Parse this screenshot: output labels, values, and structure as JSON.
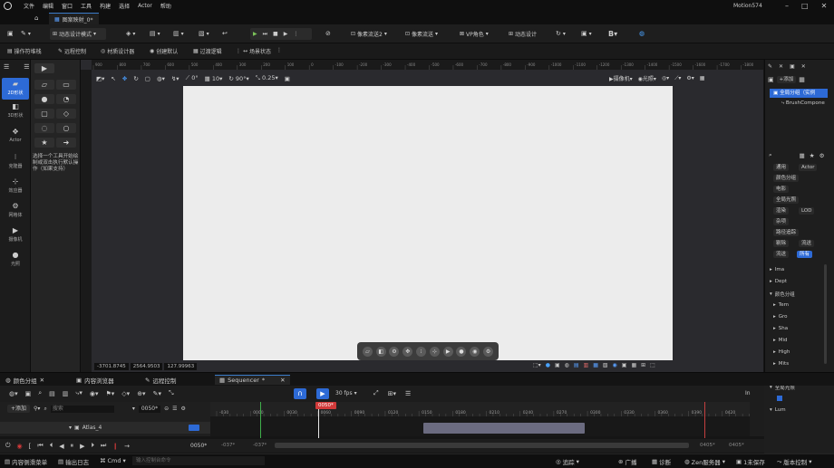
{
  "app": {
    "title": "Motion574",
    "logo": "unreal-engine-logo"
  },
  "menu": [
    "文件",
    "编辑",
    "窗口",
    "工具",
    "构建",
    "选择",
    "Actor",
    "帮助"
  ],
  "window_controls": [
    "minimize",
    "maximize",
    "close"
  ],
  "document_tab": {
    "label": "图案映射_0*"
  },
  "toolbar": {
    "mode_label": "动态设计模式",
    "pixel_stream_1": "像素流送2",
    "pixel_stream_2": "像素流送",
    "vp_role": "VP角色",
    "motion_design": "动态设计"
  },
  "toolbar2": {
    "ops_menu": "操作符堆栈",
    "remote": "远程控制",
    "material_designer": "材质设计器",
    "create_default": "创建默认",
    "transition_logic": "过渡逻辑",
    "scene_state": "场景状态"
  },
  "left_rail": [
    {
      "label": "2D形状",
      "icon": "square-icon",
      "active": true
    },
    {
      "label": "3D形状",
      "icon": "cube-icon",
      "active": false
    },
    {
      "label": "Actor",
      "icon": "move-icon",
      "active": false
    },
    {
      "label": "克隆器",
      "icon": "cloner-icon",
      "active": false
    },
    {
      "label": "效应器",
      "icon": "effector-icon",
      "active": false
    },
    {
      "label": "网格体",
      "icon": "mesh-icon",
      "active": false
    },
    {
      "label": "摄像机",
      "icon": "camera-icon",
      "active": false
    },
    {
      "label": "光照",
      "icon": "light-icon",
      "active": false
    }
  ],
  "palette_hint": "选择一个工具开始绘制或双击执行默认操作（如果支持）",
  "viewport": {
    "snap_angle": "0°",
    "grid": "10",
    "rotation": "90°",
    "scale": "0.25",
    "camera_btn": "摄像机",
    "lit_btn": "光照"
  },
  "ruler_ticks": [
    "900",
    "800",
    "700",
    "600",
    "500",
    "400",
    "300",
    "200",
    "100",
    "0",
    "-100",
    "-200",
    "-300",
    "-400",
    "-500",
    "-600",
    "-700",
    "-800",
    "-900",
    "-1000",
    "-1100",
    "-1200",
    "-1300",
    "-1400",
    "-1500",
    "-1600",
    "-1700",
    "-1800"
  ],
  "coords": {
    "x": "-3701.8745",
    "y": "2564.9503",
    "z": "127.99963"
  },
  "right_panel": {
    "add_btn": "+添加",
    "root_item": "全局分组（实例",
    "child_item": "BrushCompone",
    "tags": [
      "通用",
      "Actor",
      "颜色分组",
      "电影",
      "全局光照",
      "渲染",
      "LOD",
      "杂项",
      "路径追踪",
      "剔除",
      "流送",
      "流送",
      "所有"
    ],
    "props": [
      "Ima",
      "Dept",
      "颜色分组",
      "Tem",
      "Gro",
      "Sha",
      "Mid",
      "High",
      "Mits",
      "电影",
      "全局光照",
      "Lum"
    ]
  },
  "bottom_tabs": [
    {
      "label": "颜色分组",
      "active": false
    },
    {
      "label": "内容浏览器",
      "active": false
    },
    {
      "label": "远程控制",
      "active": false
    },
    {
      "label": "Sequencer",
      "active": true
    }
  ],
  "sequencer": {
    "add": "+添加",
    "search": "搜索",
    "fps": "30 fps",
    "track": "Atlas_4",
    "current_frame": "0050*",
    "playhead": "0050*",
    "start_left": "-037*",
    "start_right": "-037*",
    "end_left": "0405*",
    "end_right": "0405*",
    "ruler": [
      "-030",
      "0000",
      "0030",
      "0060",
      "0090",
      "0120",
      "0150",
      "0180",
      "0210",
      "0240",
      "0270",
      "0300",
      "0330",
      "0360",
      "0390",
      "0420"
    ]
  },
  "status": {
    "drawer": "内容侧滑菜单",
    "output": "输出日志",
    "cmd": "Cmd",
    "console_placeholder": "输入控制台命令",
    "trace": "追踪",
    "broadcast": "广播",
    "diag": "诊断",
    "zen": "Zen服务器",
    "unsaved": "1未保存",
    "source": "版本控制"
  }
}
